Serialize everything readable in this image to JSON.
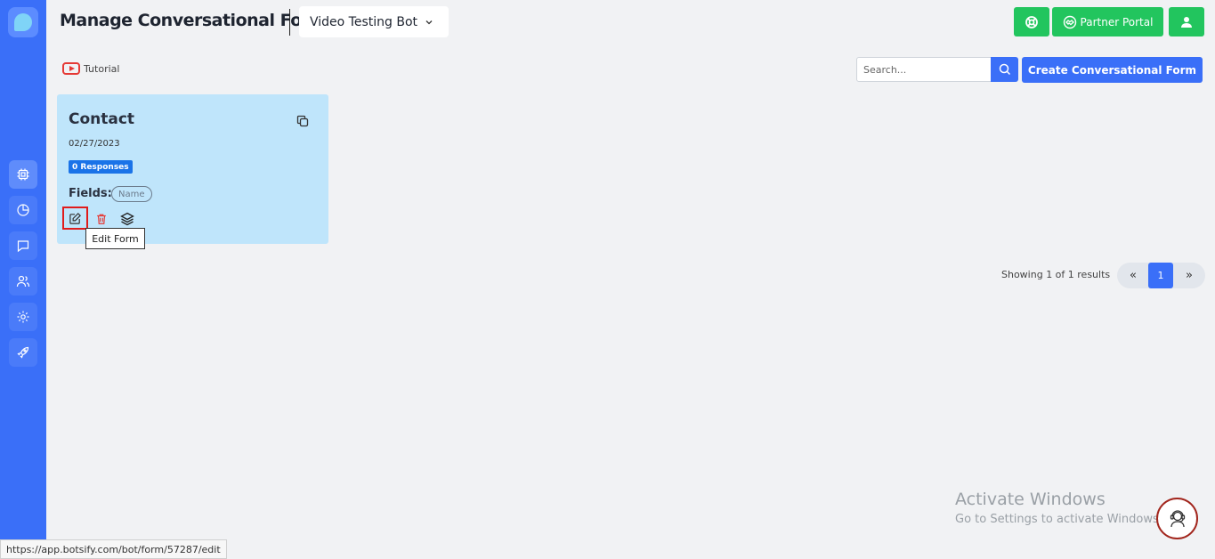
{
  "header": {
    "title": "Manage Conversational Forms",
    "bot_name": "Video Testing Bot",
    "partner_label": "Partner Portal"
  },
  "toolbar": {
    "tutorial_label": "Tutorial",
    "search_placeholder": "Search...",
    "create_label": "Create Conversational Form"
  },
  "forms": [
    {
      "title": "Contact",
      "date": "02/27/2023",
      "responses": "0 Responses",
      "fields_label": "Fields:",
      "fields": [
        "Name"
      ]
    }
  ],
  "tooltip": "Edit Form",
  "pagination": {
    "summary": "Showing 1 of 1 results",
    "prev": "«",
    "current": "1",
    "next": "»"
  },
  "watermark": {
    "title": "Activate Windows",
    "subtitle": "Go to Settings to activate Windows."
  },
  "status_url": "https://app.botsify.com/bot/form/57287/edit",
  "colors": {
    "primary": "#3a6ff8",
    "success": "#22c55e",
    "card": "#bfe5fb",
    "danger": "#e53935"
  },
  "sidebar_icons": [
    "cpu-icon",
    "pie-chart-icon",
    "chat-icon",
    "users-icon",
    "settings-icon",
    "rocket-icon"
  ]
}
